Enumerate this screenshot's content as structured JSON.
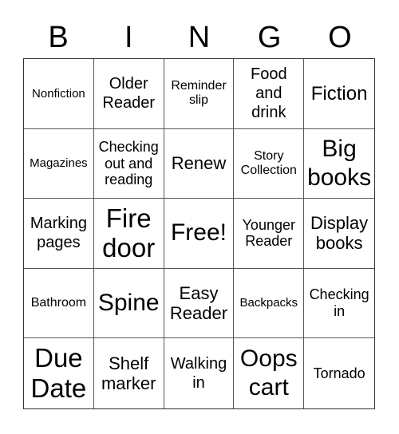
{
  "header": {
    "letters": [
      "B",
      "I",
      "N",
      "G",
      "O"
    ]
  },
  "cells": [
    "Nonfiction",
    "Older Reader",
    "Reminder slip",
    "Food and drink",
    "Fiction",
    "Magazines",
    "Checking out and reading",
    "Renew",
    "Story Collection",
    "Big books",
    "Marking pages",
    "Fire door",
    "Free!",
    "Younger Reader",
    "Display books",
    "Bathroom",
    "Spine",
    "Easy Reader",
    "Backpacks",
    "Checking in",
    "Due Date",
    "Shelf marker",
    "Walking in",
    "Oops cart",
    "Tornado"
  ]
}
